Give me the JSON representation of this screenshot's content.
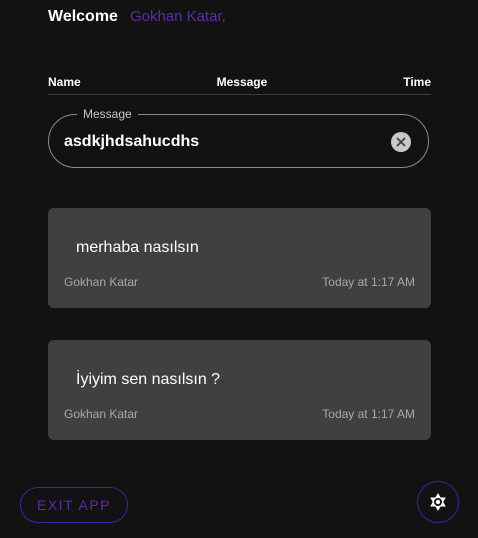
{
  "header": {
    "welcome_label": "Welcome",
    "user_name": "Gokhan Katar,"
  },
  "columns": [
    "Name",
    "Message",
    "Time"
  ],
  "message_field": {
    "label": "Message",
    "value": "asdkjhdsahucdhs"
  },
  "messages": [
    {
      "text": "merhaba nasılsın",
      "author": "Gokhan Katar",
      "time": "Today at 1:17 AM"
    },
    {
      "text": "İyiyim sen nasılsın ?",
      "author": "Gokhan Katar",
      "time": "Today at 1:17 AM"
    }
  ],
  "footer": {
    "exit_label": "EXIT APP",
    "theme_icon": "brightness-icon"
  },
  "colors": {
    "background": "#121212",
    "card": "#404040",
    "accent": "#5b2ea6"
  }
}
